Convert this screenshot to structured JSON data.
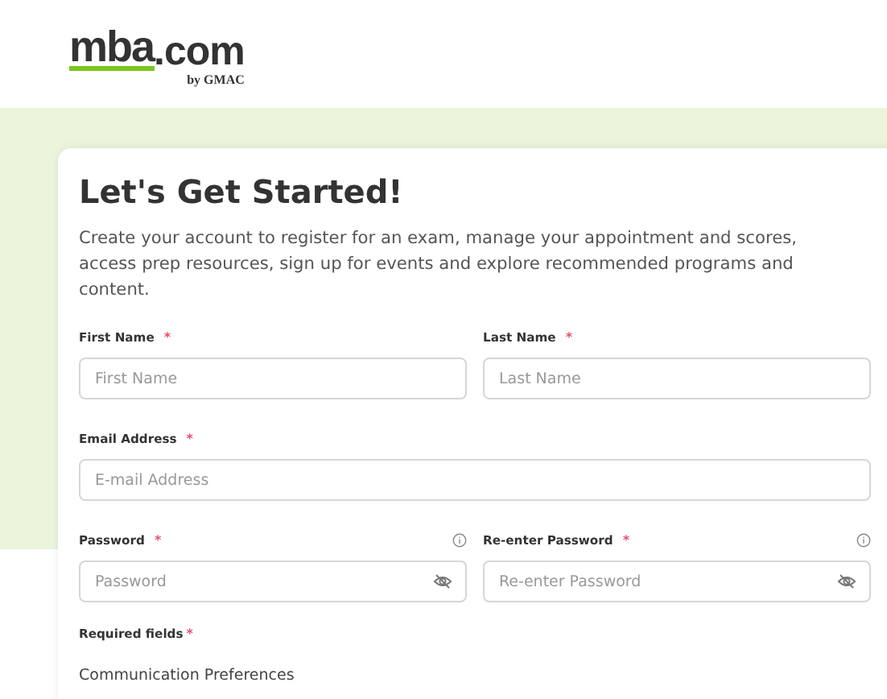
{
  "logo": {
    "main": "mba",
    "suffix": ".com",
    "tagline": "by GMAC"
  },
  "card": {
    "title": "Let's Get Started!",
    "intro": "Create your account to register for an exam, manage your appointment and scores, access prep resources, sign up for events and explore recommended programs and content.",
    "fields": [
      {
        "kind": "name",
        "label": "First Name",
        "required_mark": "*",
        "placeholder": "First Name"
      },
      {
        "kind": "name",
        "label": "Last Name",
        "required_mark": "*",
        "placeholder": "Last Name"
      },
      {
        "kind": "email",
        "label": "Email Address",
        "required_mark": "*",
        "placeholder": "E-mail Address"
      },
      {
        "kind": "password",
        "label": "Password",
        "required_mark": "*",
        "placeholder": "Password"
      },
      {
        "kind": "password",
        "label": "Re-enter Password",
        "required_mark": "*",
        "placeholder": "Re-enter Password"
      }
    ],
    "required_note": {
      "text": "Required fields",
      "mark": "*"
    },
    "section_heading": "Communication Preferences"
  }
}
